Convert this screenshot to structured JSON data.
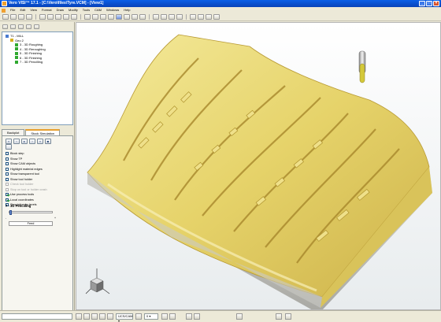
{
  "window": {
    "title": "Vero VISI™ 17.1 - [C:\\Vero\\files\\Tyre.VCM] - [View1]"
  },
  "menu": [
    "File",
    "Edit",
    "View",
    "Format",
    "Draw",
    "Modify",
    "Tools",
    "CAM",
    "Windows",
    "Help"
  ],
  "tree": {
    "root": "T1 - MILL",
    "group": "Geo 2",
    "ops": [
      "3 - 3D Roughing",
      "4 - 3D Reroughing",
      "5 - 3D Finishing",
      "6 - 3D Finishing",
      "7 - 3D Pencilling"
    ]
  },
  "tabs": {
    "backplot": "Backplot",
    "stock": "Stock Simulation"
  },
  "options": {
    "block_step": "Block step",
    "show_tp": "Show TP",
    "show_cam": "Show CAM objects",
    "highlight": "Highlight material edges",
    "transparent": "Show transparent tool",
    "toolholder": "Show tool holder",
    "check_toolholder": "Check tool holder",
    "stop_crash": "Stop on tool or holder crash",
    "process_tools": "Use process tools",
    "local_coords": "Local coordinates",
    "sim_levels": "Simulation by levels"
  },
  "current_op": "7 - 3D Pencilling",
  "feed_label": "Feed",
  "status": {
    "ucs": "UCS/CAM",
    "layer": "0"
  },
  "colors": {
    "part": "#e8d870",
    "base": "#c9c9c4",
    "tool": "#d4c93a"
  }
}
